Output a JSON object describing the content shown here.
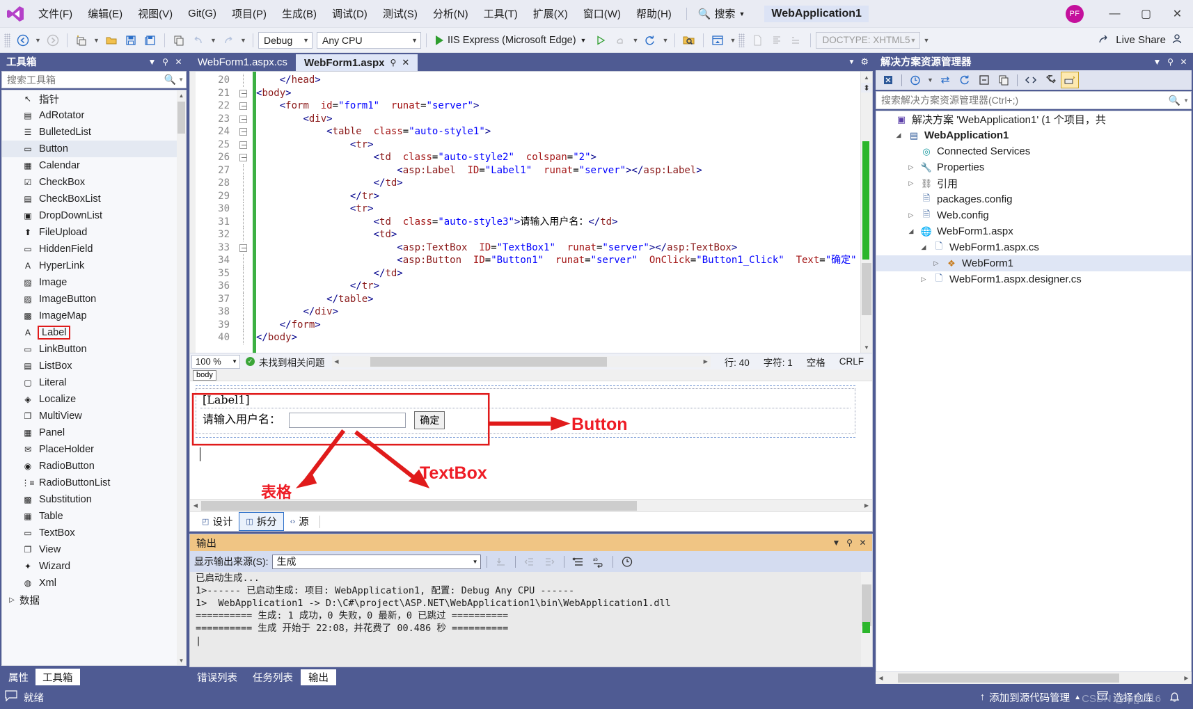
{
  "titlebar": {
    "logo": "vs-logo",
    "menu": [
      "文件(F)",
      "编辑(E)",
      "视图(V)",
      "Git(G)",
      "项目(P)",
      "生成(B)",
      "调试(D)",
      "测试(S)",
      "分析(N)",
      "工具(T)",
      "扩展(X)",
      "窗口(W)",
      "帮助(H)"
    ],
    "search_label": "搜索",
    "app_title": "WebApplication1",
    "avatar_initials": "PF",
    "minimize": "—",
    "maximize": "▢",
    "close": "✕"
  },
  "toolbar": {
    "configuration": "Debug",
    "platform": "Any CPU",
    "run_target": "IIS Express (Microsoft Edge)",
    "doctype": "DOCTYPE: XHTML5",
    "live_share": "Live Share"
  },
  "toolbox": {
    "title": "工具箱",
    "search_placeholder": "搜索工具箱",
    "items": [
      {
        "label": "指针",
        "icon": "pointer-icon"
      },
      {
        "label": "AdRotator",
        "icon": "adrotator-icon"
      },
      {
        "label": "BulletedList",
        "icon": "bulletedlist-icon"
      },
      {
        "label": "Button",
        "icon": "button-icon"
      },
      {
        "label": "Calendar",
        "icon": "calendar-icon"
      },
      {
        "label": "CheckBox",
        "icon": "checkbox-icon"
      },
      {
        "label": "CheckBoxList",
        "icon": "checkboxlist-icon"
      },
      {
        "label": "DropDownList",
        "icon": "dropdownlist-icon"
      },
      {
        "label": "FileUpload",
        "icon": "fileupload-icon"
      },
      {
        "label": "HiddenField",
        "icon": "hiddenfield-icon"
      },
      {
        "label": "HyperLink",
        "icon": "hyperlink-icon"
      },
      {
        "label": "Image",
        "icon": "image-icon"
      },
      {
        "label": "ImageButton",
        "icon": "imagebutton-icon"
      },
      {
        "label": "ImageMap",
        "icon": "imagemap-icon"
      },
      {
        "label": "Label",
        "icon": "label-icon"
      },
      {
        "label": "LinkButton",
        "icon": "linkbutton-icon"
      },
      {
        "label": "ListBox",
        "icon": "listbox-icon"
      },
      {
        "label": "Literal",
        "icon": "literal-icon"
      },
      {
        "label": "Localize",
        "icon": "localize-icon"
      },
      {
        "label": "MultiView",
        "icon": "multiview-icon"
      },
      {
        "label": "Panel",
        "icon": "panel-icon"
      },
      {
        "label": "PlaceHolder",
        "icon": "placeholder-icon"
      },
      {
        "label": "RadioButton",
        "icon": "radiobutton-icon"
      },
      {
        "label": "RadioButtonList",
        "icon": "radiobuttonlist-icon"
      },
      {
        "label": "Substitution",
        "icon": "substitution-icon"
      },
      {
        "label": "Table",
        "icon": "table-icon"
      },
      {
        "label": "TextBox",
        "icon": "textbox-icon"
      },
      {
        "label": "View",
        "icon": "view-icon"
      },
      {
        "label": "Wizard",
        "icon": "wizard-icon"
      },
      {
        "label": "Xml",
        "icon": "xml-icon"
      }
    ],
    "group_data": "数据",
    "selected_item": "Button",
    "highlighted_item": "Label",
    "tabs": [
      {
        "label": "属性",
        "active": false
      },
      {
        "label": "工具箱",
        "active": true
      }
    ]
  },
  "editor": {
    "tabs": [
      {
        "label": "WebForm1.aspx.cs",
        "active": false
      },
      {
        "label": "WebForm1.aspx",
        "active": true
      }
    ],
    "line_numbers": [
      20,
      21,
      22,
      23,
      24,
      25,
      26,
      27,
      28,
      29,
      30,
      31,
      32,
      33,
      34,
      35,
      36,
      37,
      38,
      39,
      40
    ],
    "code_lines": [
      "    </head>",
      "<body>",
      "    <form id=\"form1\" runat=\"server\">",
      "        <div>",
      "            <table class=\"auto-style1\">",
      "                <tr>",
      "                    <td class=\"auto-style2\" colspan=\"2\">",
      "                        <asp:Label ID=\"Label1\" runat=\"server\"></asp:Label>",
      "                    </td>",
      "                </tr>",
      "                <tr>",
      "                    <td class=\"auto-style3\">请输入用户名：</td>",
      "                    <td>",
      "                        <asp:TextBox ID=\"TextBox1\" runat=\"server\"></asp:TextBox>",
      "                        <asp:Button ID=\"Button1\" runat=\"server\" OnClick=\"Button1_Click\" Text=\"确定\" />",
      "                    </td>",
      "                </tr>",
      "            </table>",
      "        </div>",
      "    </form>",
      "</body>"
    ],
    "status": {
      "zoom": "100 %",
      "problems": "未找到相关问题",
      "line": "行: 40",
      "col": "字符: 1",
      "spaces": "空格",
      "eol": "CRLF"
    }
  },
  "design": {
    "tag_path": "body",
    "label_placeholder": "[Label1]",
    "prompt_text": "请输入用户名：",
    "button_text": "确定",
    "annotations": [
      {
        "text": "Button",
        "target": "button"
      },
      {
        "text": "TextBox",
        "target": "textbox"
      },
      {
        "text": "表格",
        "target": "table"
      }
    ],
    "view_tabs": [
      {
        "label": "设计",
        "active": false,
        "icon": "design-icon"
      },
      {
        "label": "拆分",
        "active": true,
        "icon": "split-icon"
      },
      {
        "label": "源",
        "active": false,
        "icon": "source-icon"
      }
    ]
  },
  "output": {
    "title": "输出",
    "source_label": "显示输出来源(S):",
    "source_value": "生成",
    "lines": [
      "已启动生成...",
      "1>------ 已启动生成: 项目: WebApplication1, 配置: Debug Any CPU ------",
      "1>  WebApplication1 -> D:\\C#\\project\\ASP.NET\\WebApplication1\\bin\\WebApplication1.dll",
      "========== 生成: 1 成功，0 失败，0 最新，0 已跳过 ==========",
      "========== 生成 开始于 22:08，并花费了 00.486 秒 =========="
    ],
    "tabs": [
      {
        "label": "错误列表",
        "active": false
      },
      {
        "label": "任务列表",
        "active": false
      },
      {
        "label": "输出",
        "active": true
      }
    ]
  },
  "solution": {
    "title": "解决方案资源管理器",
    "search_placeholder": "搜索解决方案资源管理器(Ctrl+;)",
    "tree": [
      {
        "label": "解决方案 'WebApplication1' (1 个项目，共",
        "indent": 0,
        "expander": "",
        "icon": "solution-icon",
        "bold": false,
        "selected": false
      },
      {
        "label": "WebApplication1",
        "indent": 1,
        "expander": "▲",
        "icon": "project-icon",
        "bold": true,
        "selected": false
      },
      {
        "label": "Connected Services",
        "indent": 2,
        "expander": "",
        "icon": "connected-services-icon",
        "bold": false,
        "selected": false
      },
      {
        "label": "Properties",
        "indent": 2,
        "expander": "▷",
        "icon": "properties-icon",
        "bold": false,
        "selected": false
      },
      {
        "label": "引用",
        "indent": 2,
        "expander": "▷",
        "icon": "references-icon",
        "bold": false,
        "selected": false
      },
      {
        "label": "packages.config",
        "indent": 2,
        "expander": "",
        "icon": "config-file-icon",
        "bold": false,
        "selected": false
      },
      {
        "label": "Web.config",
        "indent": 2,
        "expander": "▷",
        "icon": "config-file-icon",
        "bold": false,
        "selected": false
      },
      {
        "label": "WebForm1.aspx",
        "indent": 2,
        "expander": "▲",
        "icon": "aspx-file-icon",
        "bold": false,
        "selected": false
      },
      {
        "label": "WebForm1.aspx.cs",
        "indent": 3,
        "expander": "▲",
        "icon": "cs-file-icon",
        "bold": false,
        "selected": false
      },
      {
        "label": "WebForm1",
        "indent": 4,
        "expander": "▷",
        "icon": "class-icon",
        "bold": false,
        "selected": true
      },
      {
        "label": "WebForm1.aspx.designer.cs",
        "indent": 3,
        "expander": "▷",
        "icon": "cs-file-icon",
        "bold": false,
        "selected": false
      }
    ]
  },
  "statusbar": {
    "ready": "就绪",
    "source_control": "添加到源代码管理",
    "repo": "选择仓库",
    "watermark": "CSDN @fp[]1116"
  }
}
